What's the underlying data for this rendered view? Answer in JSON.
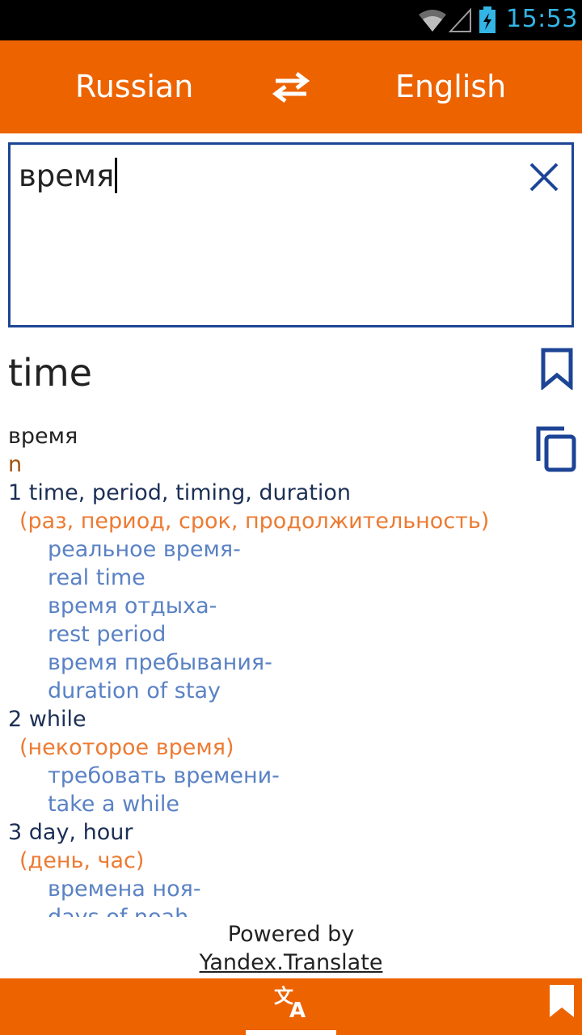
{
  "status_bar": {
    "time": "15:53",
    "icons": [
      "wifi-icon",
      "signal-icon",
      "battery-charging-icon"
    ],
    "clock_color": "#33b5e5"
  },
  "header": {
    "source_language": "Russian",
    "target_language": "English",
    "swap_icon": "swap-arrows-icon",
    "background": "#ec6300"
  },
  "input": {
    "value": "время",
    "clear_icon": "close-icon",
    "border_color": "#1d4596"
  },
  "result": {
    "translation": "time",
    "bookmark_icon": "bookmark-icon",
    "copy_icon": "copy-icon"
  },
  "dictionary": {
    "source_word": "время",
    "part_of_speech": "n",
    "meanings": [
      {
        "definition": "1 time, period, timing, duration",
        "synonyms": "(раз, период, срок, продолжительность)",
        "examples": [
          "реальное время-",
          "real time",
          "время отдыха-",
          "rest period",
          "время пребывания-",
          "duration of stay"
        ]
      },
      {
        "definition": "2 while",
        "synonyms": "(некоторое время)",
        "examples": [
          "требовать времени-",
          "take a while"
        ]
      },
      {
        "definition": "3 day, hour",
        "synonyms": "(день, час)",
        "examples": [
          "времена ноя-",
          "days of noah"
        ]
      }
    ]
  },
  "footer": {
    "powered_by": "Powered by",
    "provider_link": "Yandex.Translate"
  },
  "bottom_nav": {
    "tabs": [
      {
        "name": "translate",
        "icon": "translate-icon",
        "active": true
      },
      {
        "name": "bookmarks",
        "icon": "bookmark-icon",
        "active": false
      }
    ]
  }
}
